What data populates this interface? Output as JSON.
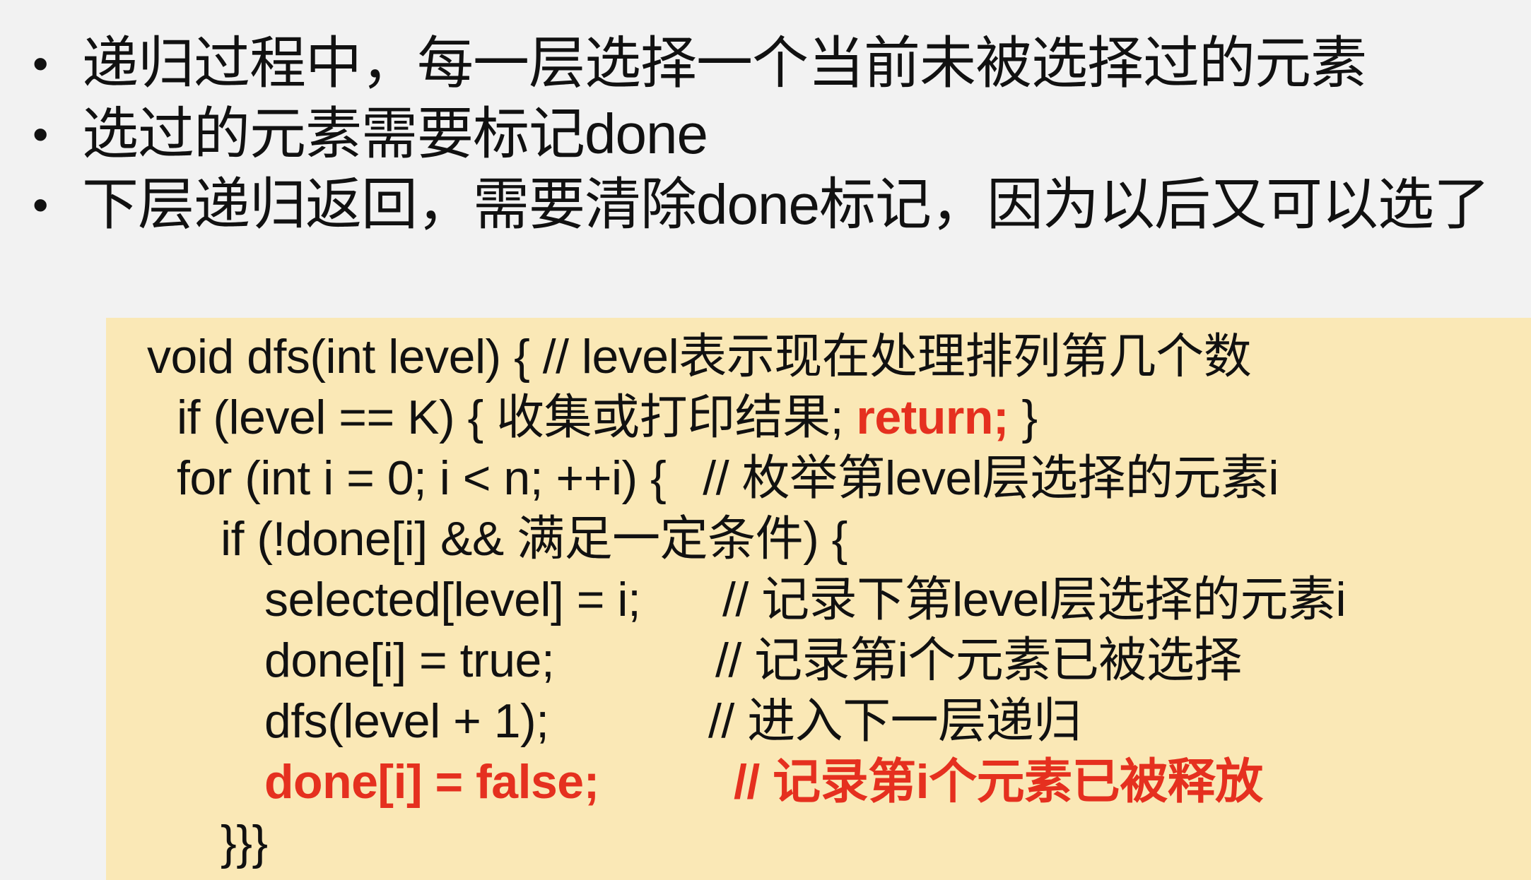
{
  "bullets": [
    "递归过程中，每一层选择一个当前未被选择过的元素",
    "选过的元素需要标记done",
    "下层递归返回，需要清除done标记，因为以后又可以选了"
  ],
  "bullet_symbol": "•",
  "code": {
    "line1": "void dfs(int level) { // level表示现在处理排列第几个数",
    "line2_pre": "if (level == K) { 收集或打印结果; ",
    "line2_red": "return;",
    "line2_post": " }",
    "line3_code": "for (int i = 0; i < n; ++i) {",
    "line3_comment": "// 枚举第level层选择的元素i",
    "line4": "if (!done[i] && 满足一定条件) {",
    "line5_code": "selected[level] = i;",
    "line5_comment": "// 记录下第level层选择的元素i",
    "line6_code": "done[i] = true;",
    "line6_comment": "//  记录第i个元素已被选择",
    "line7_code": "dfs(level + 1);",
    "line7_comment": "// 进入下一层递归",
    "line8_code": "done[i] = false;",
    "line8_comment": "//  记录第i个元素已被释放",
    "line9": "}}}"
  },
  "colors": {
    "background": "#f2f2f2",
    "code_background": "#fae8b6",
    "highlight_red": "#e5301f",
    "text": "#111111"
  }
}
